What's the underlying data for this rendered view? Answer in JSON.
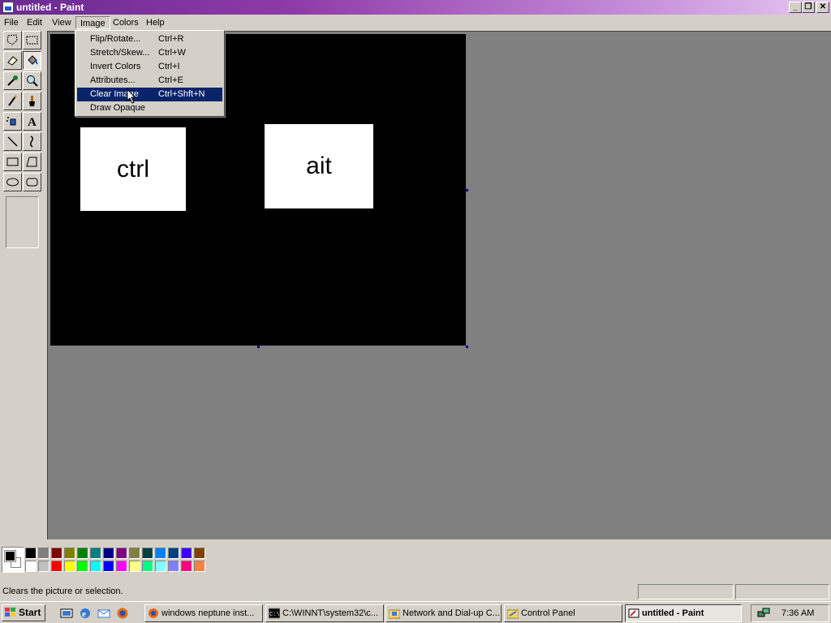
{
  "window": {
    "title": "untitled - Paint"
  },
  "menubar": {
    "items": [
      "File",
      "Edit",
      "View",
      "Image",
      "Colors",
      "Help"
    ]
  },
  "image_menu": {
    "items": [
      {
        "label": "Flip/Rotate...",
        "shortcut": "Ctrl+R"
      },
      {
        "label": "Stretch/Skew...",
        "shortcut": "Ctrl+W"
      },
      {
        "label": "Invert Colors",
        "shortcut": "Ctrl+I"
      },
      {
        "label": "Attributes...",
        "shortcut": "Ctrl+E"
      },
      {
        "label": "Clear Image",
        "shortcut": "Ctrl+Shft+N",
        "highlighted": true
      },
      {
        "label": "Draw Opaque",
        "shortcut": ""
      }
    ]
  },
  "canvas": {
    "background": "#000000",
    "boxes": [
      "ctrl",
      "ait"
    ]
  },
  "palette": {
    "primary": "#000000",
    "secondary": "#ffffff",
    "top_row": [
      "#000000",
      "#808080",
      "#800000",
      "#808000",
      "#008000",
      "#008080",
      "#000080",
      "#800080",
      "#808040",
      "#004040",
      "#0080ff",
      "#004080",
      "#4000ff",
      "#804000"
    ],
    "bottom_row": [
      "#ffffff",
      "#c0c0c0",
      "#ff0000",
      "#ffff00",
      "#00ff00",
      "#00ffff",
      "#0000ff",
      "#ff00ff",
      "#ffff80",
      "#00ff80",
      "#80ffff",
      "#8080ff",
      "#ff0080",
      "#ff8040"
    ]
  },
  "statusbar": {
    "text": "Clears the picture or selection."
  },
  "taskbar": {
    "start_label": "Start",
    "tasks": [
      {
        "label": "windows neptune inst..."
      },
      {
        "label": "C:\\WINNT\\system32\\c..."
      },
      {
        "label": "Network and Dial-up C..."
      },
      {
        "label": "Control Panel"
      },
      {
        "label": "untitled - Paint",
        "active": true
      }
    ],
    "clock": "7:36 AM"
  }
}
